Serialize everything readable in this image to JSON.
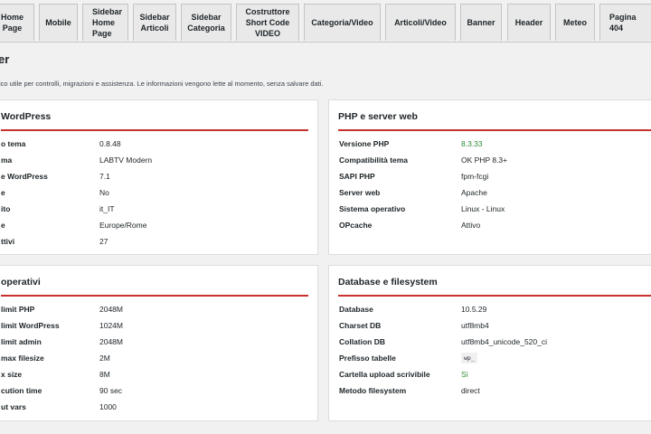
{
  "tabs": [
    {
      "label": "Home\nPage"
    },
    {
      "label": "Mobile"
    },
    {
      "label": "Sidebar\nHome\nPage"
    },
    {
      "label": "Sidebar\nArticoli"
    },
    {
      "label": "Sidebar\nCategoria"
    },
    {
      "label": "Costruttore\nShort Code\nVIDEO"
    },
    {
      "label": "Categoria/Video"
    },
    {
      "label": "Articoli/Video"
    },
    {
      "label": "Banner"
    },
    {
      "label": "Header"
    },
    {
      "label": "Meteo"
    },
    {
      "label": "Pagina\n404"
    }
  ],
  "page": {
    "title": "er",
    "intro": "ico utile per controlli, migrazioni e assistenza. Le informazioni vengono lette al momento, senza salvare dati."
  },
  "cards": {
    "wordpress": {
      "title": "WordPress",
      "rows": [
        {
          "k": "o tema",
          "v": "0.8.48"
        },
        {
          "k": "ma",
          "v": "LABTV Modern"
        },
        {
          "k": "e WordPress",
          "v": "7.1"
        },
        {
          "k": "e",
          "v": "No"
        },
        {
          "k": "ito",
          "v": "it_IT"
        },
        {
          "k": "e",
          "v": "Europe/Rome"
        },
        {
          "k": "ttivi",
          "v": "27"
        }
      ]
    },
    "php": {
      "title": "PHP e server web",
      "rows": [
        {
          "k": "Versione PHP",
          "v": "8.3.33"
        },
        {
          "k": "Compatibilità tema",
          "v": "OK PHP 8.3+"
        },
        {
          "k": "SAPI PHP",
          "v": "fpm-fcgi"
        },
        {
          "k": "Server web",
          "v": "Apache"
        },
        {
          "k": "Sistema operativo",
          "v": "Linux - Linux"
        },
        {
          "k": "OPcache",
          "v": "Attivo"
        }
      ]
    },
    "limits": {
      "title": "operativi",
      "rows": [
        {
          "k": "limit PHP",
          "v": "2048M"
        },
        {
          "k": "limit WordPress",
          "v": "1024M"
        },
        {
          "k": "limit admin",
          "v": "2048M"
        },
        {
          "k": "max filesize",
          "v": "2M"
        },
        {
          "k": "x size",
          "v": "8M"
        },
        {
          "k": "cution time",
          "v": "90 sec"
        },
        {
          "k": "ut vars",
          "v": "1000"
        }
      ]
    },
    "db": {
      "title": "Database e filesystem",
      "rows": [
        {
          "k": "Database",
          "v": "10.5.29"
        },
        {
          "k": "Charset DB",
          "v": "utf8mb4"
        },
        {
          "k": "Collation DB",
          "v": "utf8mb4_unicode_520_ci"
        },
        {
          "k": "Prefisso tabelle",
          "v": "wp_"
        },
        {
          "k": "Cartella upload scrivibile",
          "v": "Sì"
        },
        {
          "k": "Metodo filesystem",
          "v": "direct"
        }
      ]
    }
  },
  "colors": {
    "accent": "#c8312e",
    "ok": "#2e8b33"
  }
}
